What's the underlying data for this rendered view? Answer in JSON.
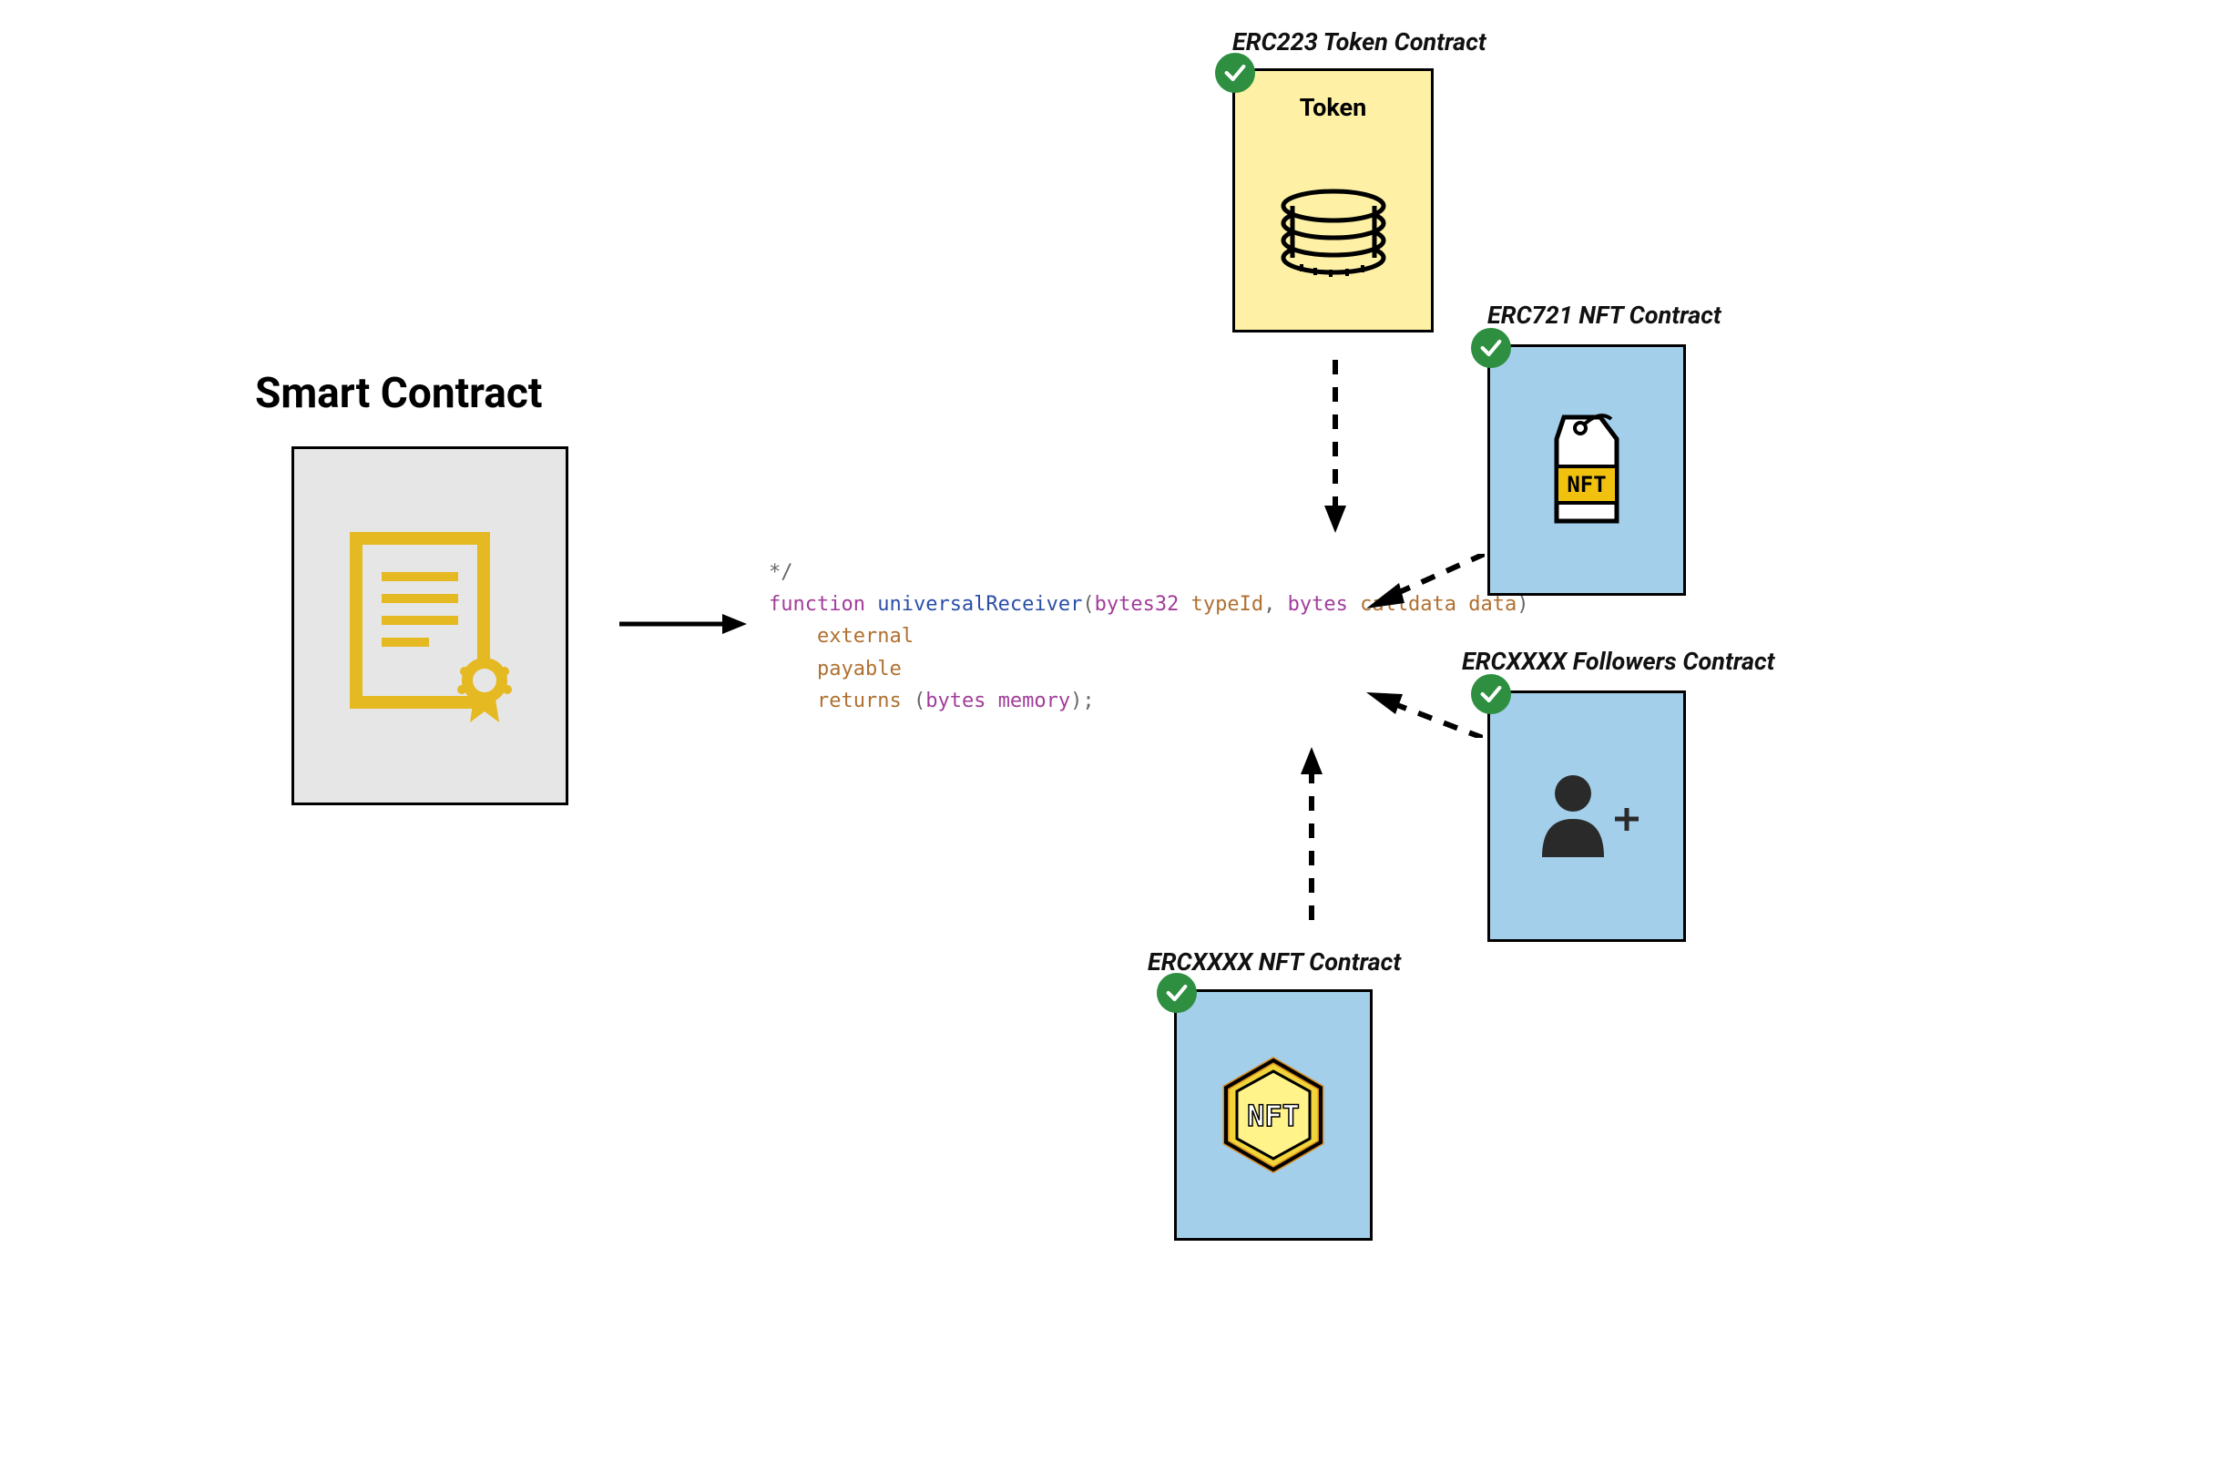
{
  "heading": "Smart Contract",
  "code": {
    "comment_end": "*/",
    "fn_kw": "function",
    "fn_name": "universalReceiver",
    "p1_type": "bytes32",
    "p1_name": "typeId",
    "comma": ",",
    "p2_type": "bytes",
    "p2_kw": "calldata",
    "p2_name": "data",
    "close_paren": ")",
    "mod1": "external",
    "mod2": "payable",
    "ret_kw": "returns",
    "ret_open": " (",
    "ret_type": "bytes",
    "ret_mem": "memory",
    "ret_close": ");"
  },
  "boxes": {
    "token": {
      "title": "ERC223 Token Contract",
      "label": "Token"
    },
    "nft721": {
      "title": "ERC721 NFT Contract"
    },
    "followers": {
      "title": "ERCXXXX Followers Contract"
    },
    "nftxxxx": {
      "title": "ERCXXXX NFT Contract"
    }
  }
}
